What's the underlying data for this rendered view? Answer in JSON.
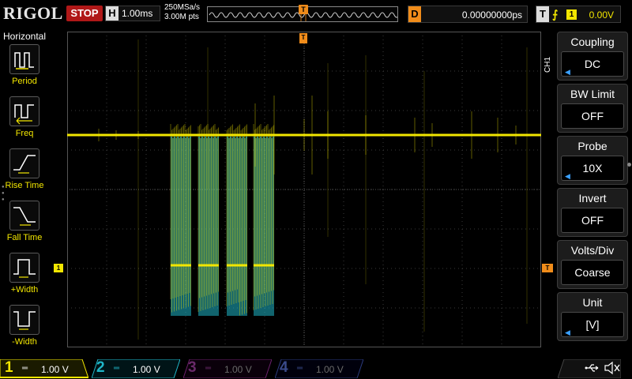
{
  "brand": "RIGOL",
  "status": "STOP",
  "horizontal": {
    "label": "H",
    "timebase": "1.00ms"
  },
  "acquisition": {
    "sample_rate": "250MSa/s",
    "memory_depth": "3.00M pts"
  },
  "delay": {
    "label": "D",
    "value": "0.00000000ps"
  },
  "trigger": {
    "label": "T",
    "source": "1",
    "level": "0.00V",
    "position_marker": "T",
    "level_marker": "T"
  },
  "left_menu": {
    "title": "Horizontal",
    "items": [
      {
        "label": "Period",
        "icon": "period-icon"
      },
      {
        "label": "Freq",
        "icon": "frequency-icon"
      },
      {
        "label": "Rise Time",
        "icon": "rise-time-icon"
      },
      {
        "label": "Fall Time",
        "icon": "fall-time-icon"
      },
      {
        "label": "+Width",
        "icon": "positive-width-icon"
      },
      {
        "label": "-Width",
        "icon": "negative-width-icon"
      }
    ]
  },
  "right_menu": {
    "channel_tab": "CH1",
    "items": [
      {
        "title": "Coupling",
        "value": "DC",
        "has_arrow": true
      },
      {
        "title": "BW Limit",
        "value": "OFF",
        "has_arrow": false
      },
      {
        "title": "Probe",
        "value": "10X",
        "has_arrow": true
      },
      {
        "title": "Invert",
        "value": "OFF",
        "has_arrow": false
      },
      {
        "title": "Volts/Div",
        "value": "Coarse",
        "has_arrow": false
      },
      {
        "title": "Unit",
        "value": "[V]",
        "has_arrow": true
      }
    ]
  },
  "channels": [
    {
      "num": "1",
      "scale": "1.00 V",
      "color": "#f2e600",
      "active": true
    },
    {
      "num": "2",
      "scale": "1.00 V",
      "color": "#1fb6c8",
      "active": true
    },
    {
      "num": "3",
      "scale": "1.00 V",
      "color": "#c040c0",
      "active": false
    },
    {
      "num": "4",
      "scale": "1.00 V",
      "color": "#3a5ad8",
      "active": false
    }
  ],
  "ch1_ground_marker": "1",
  "colors": {
    "ch1": "#f2e600",
    "ch2": "#1fb6c8",
    "trigger": "#f08c1a",
    "stop": "#b01818"
  }
}
